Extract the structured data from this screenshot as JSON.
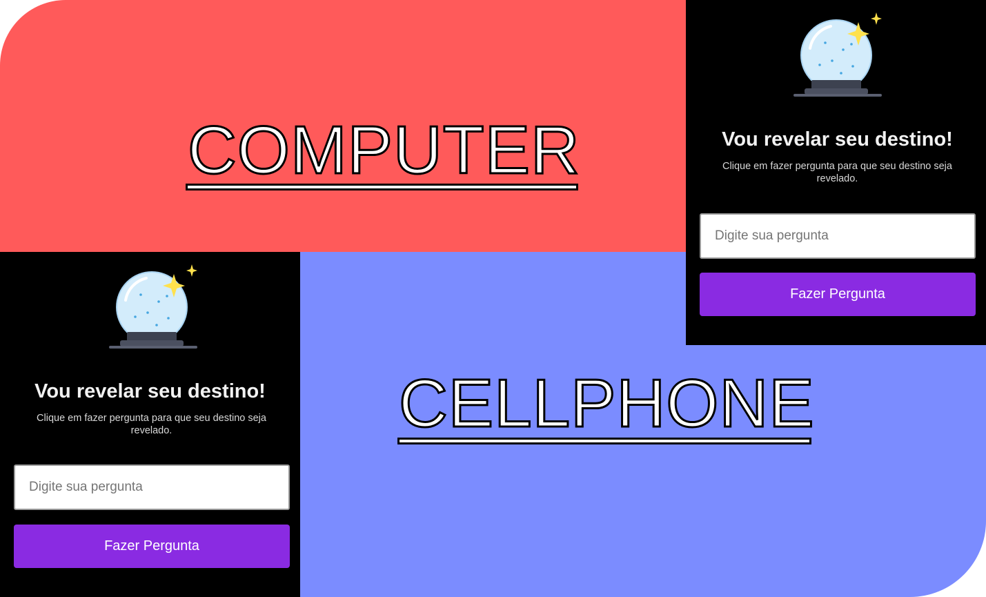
{
  "labels": {
    "computer": "COMPUTER",
    "cellphone": "CELLPHONE"
  },
  "desktop_app": {
    "icon": "crystal-ball-icon",
    "title": "Vou revelar seu destino!",
    "subtitle": "Clique em fazer pergunta para que seu destino seja revelado.",
    "input_placeholder": "Digite sua pergunta",
    "button_label": "Fazer Pergunta"
  },
  "mobile_app": {
    "icon": "crystal-ball-icon",
    "title": "Vou revelar seu destino!",
    "subtitle": "Clique em fazer pergunta para que seu destino seja revelado.",
    "input_placeholder": "Digite sua pergunta",
    "button_label": "Fazer Pergunta"
  },
  "colors": {
    "red_panel": "#ff5a5a",
    "blue_panel": "#7b8cff",
    "app_background": "#000000",
    "button": "#8a2be2"
  }
}
